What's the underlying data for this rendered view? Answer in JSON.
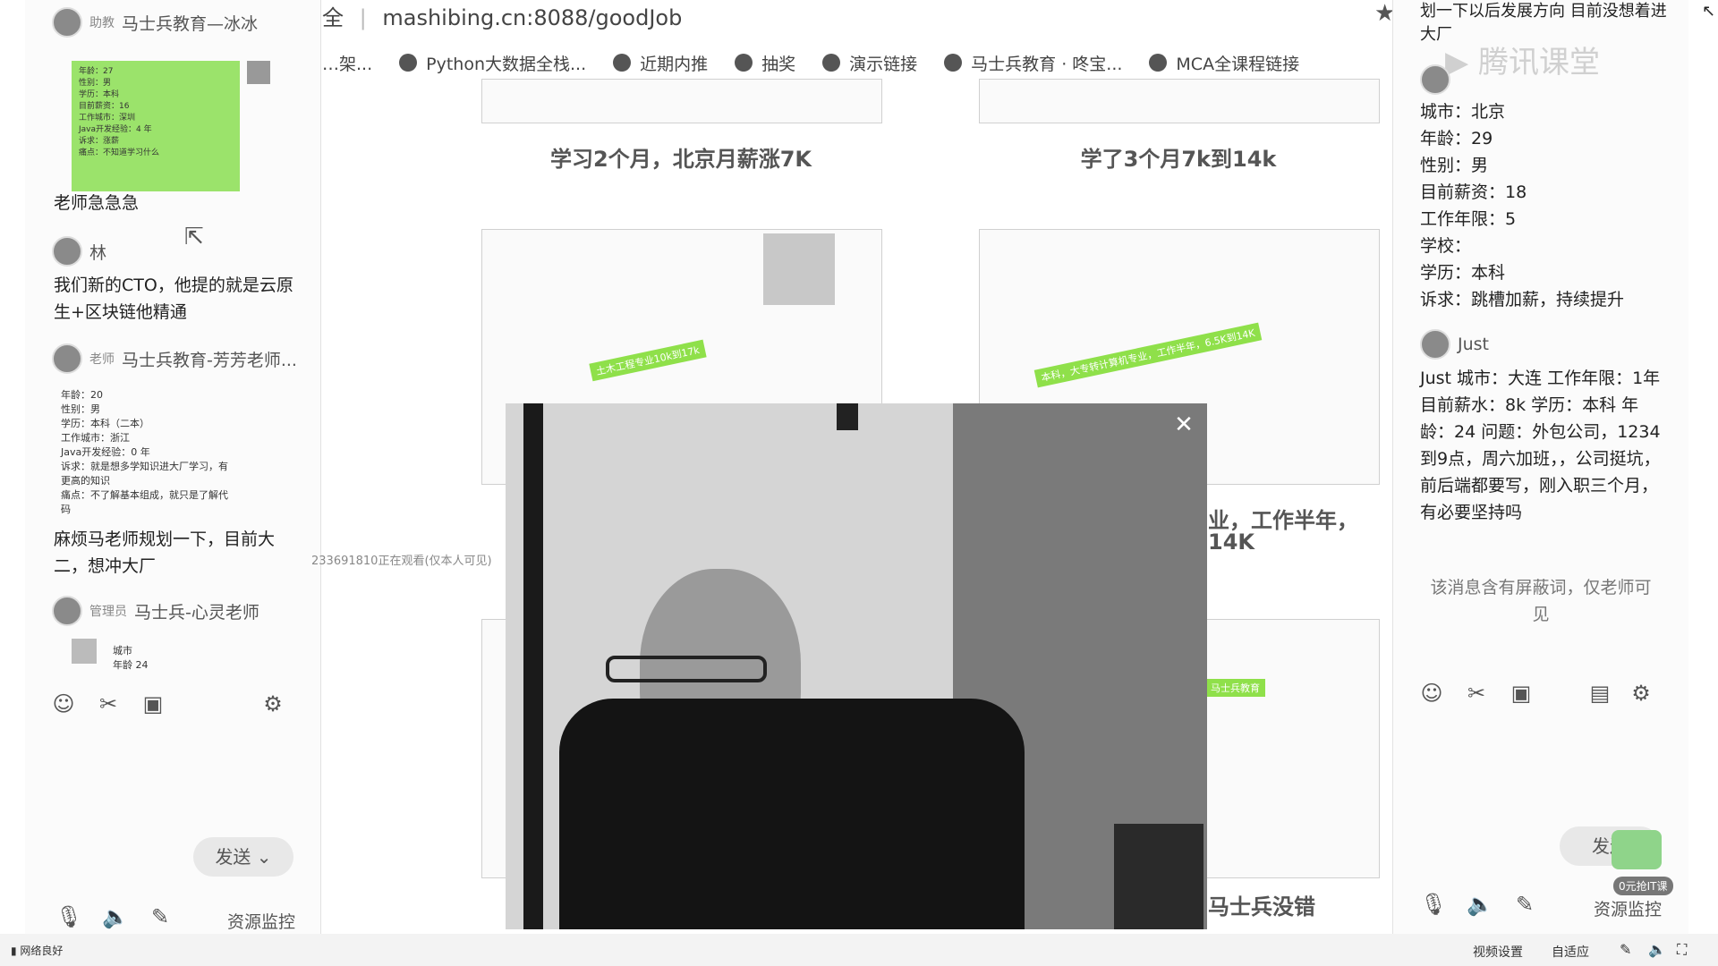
{
  "address_bar": {
    "prefix": "全",
    "url": "mashibing.cn:8088/goodJob"
  },
  "bookmarks": [
    {
      "label": "…架..."
    },
    {
      "label": "Python大数据全栈..."
    },
    {
      "label": "近期内推"
    },
    {
      "label": "抽奖"
    },
    {
      "label": "演示链接"
    },
    {
      "label": "马士兵教育 · 咚宝..."
    },
    {
      "label": "MCA全课程链接"
    }
  ],
  "left_chat": {
    "msg1": {
      "role": "助教",
      "name": "马士兵教育—冰冰",
      "text": "老师急急急"
    },
    "card1_lines": [
      "年龄：27",
      "性别：男",
      "学历：本科",
      "目前薪资：16",
      "工作城市：深圳",
      "Java开发经验：4 年",
      "诉求：涨薪",
      "痛点：不知道学习什么"
    ],
    "msg2": {
      "name": "林",
      "text": "我们新的CTO，他提的就是云原生+区块链他精通"
    },
    "msg3": {
      "role": "老师",
      "name": "马士兵教育-芳芳老师...",
      "text": "麻烦马老师规划一下，目前大二，想冲大厂"
    },
    "info_lines": [
      "年龄：20",
      "性别：男",
      "学历：本科（二本）",
      "工作城市：浙江",
      "Java开发经验：0 年",
      "诉求：就是想多学知识进大厂学习，有",
      "更高的知识",
      "痛点：不了解基本组成，就只是了解代",
      "码"
    ],
    "msg4": {
      "role": "管理员",
      "name": "马士兵-心灵老师",
      "info": [
        "城市",
        "年龄 24"
      ]
    },
    "send_label": "发送",
    "resource_label": "资源监控"
  },
  "web": {
    "captions": [
      "学习2个月，北京月薪涨7K",
      "学了3个月7k到14k",
      "业，工作半年，",
      "14K",
      "马士兵没错"
    ],
    "stripes": [
      "土木工程专业10k到17k",
      "本科，大专转计算机专业，工作半年，6.5K到14K",
      "马士兵教育"
    ]
  },
  "side_note": "233691810正在观看(仅本人可见)",
  "right_chat": {
    "top_text": "划一下以后发展方向 目前没想着进大厂",
    "watermark": "腾讯课堂",
    "profile": [
      "城市：北京",
      "年龄：29",
      "性别：男",
      "目前薪资：18",
      "工作年限：5",
      "学校：",
      "学历：本科",
      "诉求：跳槽加薪，持续提升"
    ],
    "user2": "Just",
    "user2_text": "Just 城市：大连 工作年限：1年 目前薪水：8k 学历：本科 年龄：24 问题：外包公司，1234到9点，周六加班，，公司挺坑，前后端都要写，刚入职三个月，有必要坚持吗",
    "blocked_notice": "该消息含有屏蔽词，仅老师可见",
    "send_label": "发送",
    "resource_label": "资源监控",
    "badge": "0元抢IT课"
  },
  "status_bar": {
    "network": "网络良好",
    "video_settings": "视频设置",
    "adaptive": "自适应"
  }
}
